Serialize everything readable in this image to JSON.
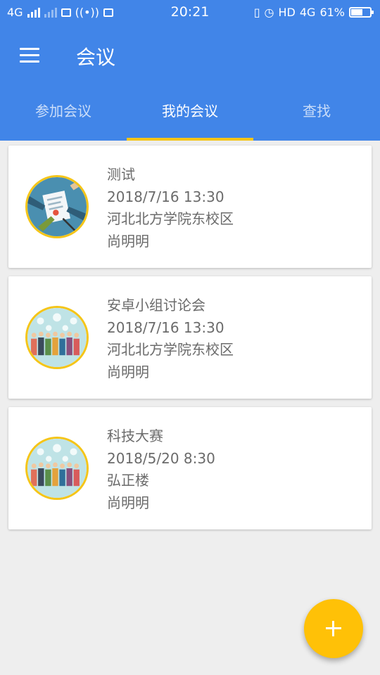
{
  "status_bar": {
    "network": "4G",
    "time": "20:21",
    "hd_label": "HD",
    "net_type": "4G",
    "battery": "61%",
    "battery_level": 0.61
  },
  "app_bar": {
    "title": "会议",
    "tabs": [
      {
        "label": "参加会议",
        "active": false
      },
      {
        "label": "我的会议",
        "active": true
      },
      {
        "label": "查找",
        "active": false
      }
    ]
  },
  "meetings": [
    {
      "title": "测试",
      "datetime": "2018/7/16 13:30",
      "location": "河北北方学院东校区",
      "organizer": "尚明明",
      "image": "handshake-contract-image"
    },
    {
      "title": "安卓小组讨论会",
      "datetime": "2018/7/16 13:30",
      "location": "河北北方学院东校区",
      "organizer": "尚明明",
      "image": "team-discussion-image"
    },
    {
      "title": "科技大赛",
      "datetime": "2018/5/20 8:30",
      "location": "弘正楼",
      "organizer": "尚明明",
      "image": "team-discussion-image"
    }
  ],
  "fab": {
    "icon": "plus-icon"
  },
  "colors": {
    "primary": "#4185e8",
    "accent": "#f5c518",
    "fab": "#ffc107",
    "background": "#eeeeee"
  }
}
